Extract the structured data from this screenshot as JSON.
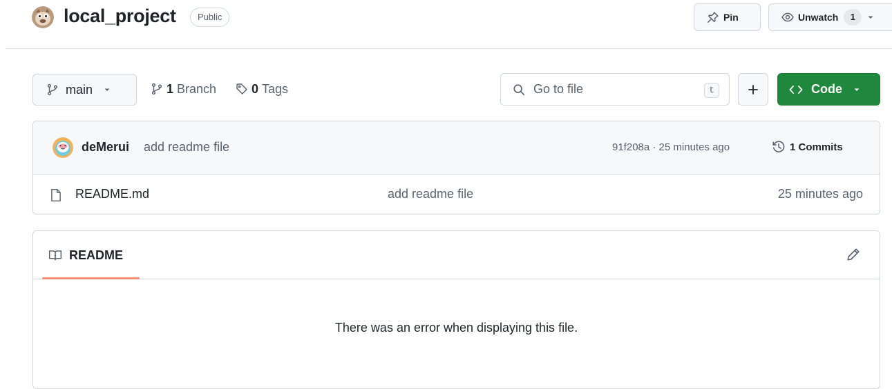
{
  "header": {
    "repo_name": "local_project",
    "visibility": "Public",
    "pin_label": "Pin",
    "watch_label": "Unwatch",
    "watch_count": "1"
  },
  "toolbar": {
    "branch_name": "main",
    "branch_count": "1",
    "branch_label": "Branch",
    "tag_count": "0",
    "tag_label": "Tags",
    "search_placeholder": "Go to file",
    "search_shortcut": "t",
    "code_label": "Code"
  },
  "latest_commit": {
    "author": "deMerui",
    "message": "add readme file",
    "meta": "91f208a · 25 minutes ago",
    "commits_label": "1 Commits"
  },
  "files": [
    {
      "name": "README.md",
      "commit_message": "add readme file",
      "age": "25 minutes ago"
    }
  ],
  "readme": {
    "tab_label": "README",
    "error_text": "There was an error when displaying this file."
  },
  "colors": {
    "primary_green": "#1f883d",
    "tab_underline": "#fd8c73",
    "border": "#d0d7de",
    "muted_text": "#59636e"
  },
  "icons": [
    "repo-owner-avatar",
    "pin-icon",
    "eye-icon",
    "caret-down-icon",
    "branch-icon",
    "tag-icon",
    "search-icon",
    "plus-icon",
    "code-icon",
    "history-icon",
    "file-icon",
    "book-icon",
    "pencil-icon"
  ]
}
